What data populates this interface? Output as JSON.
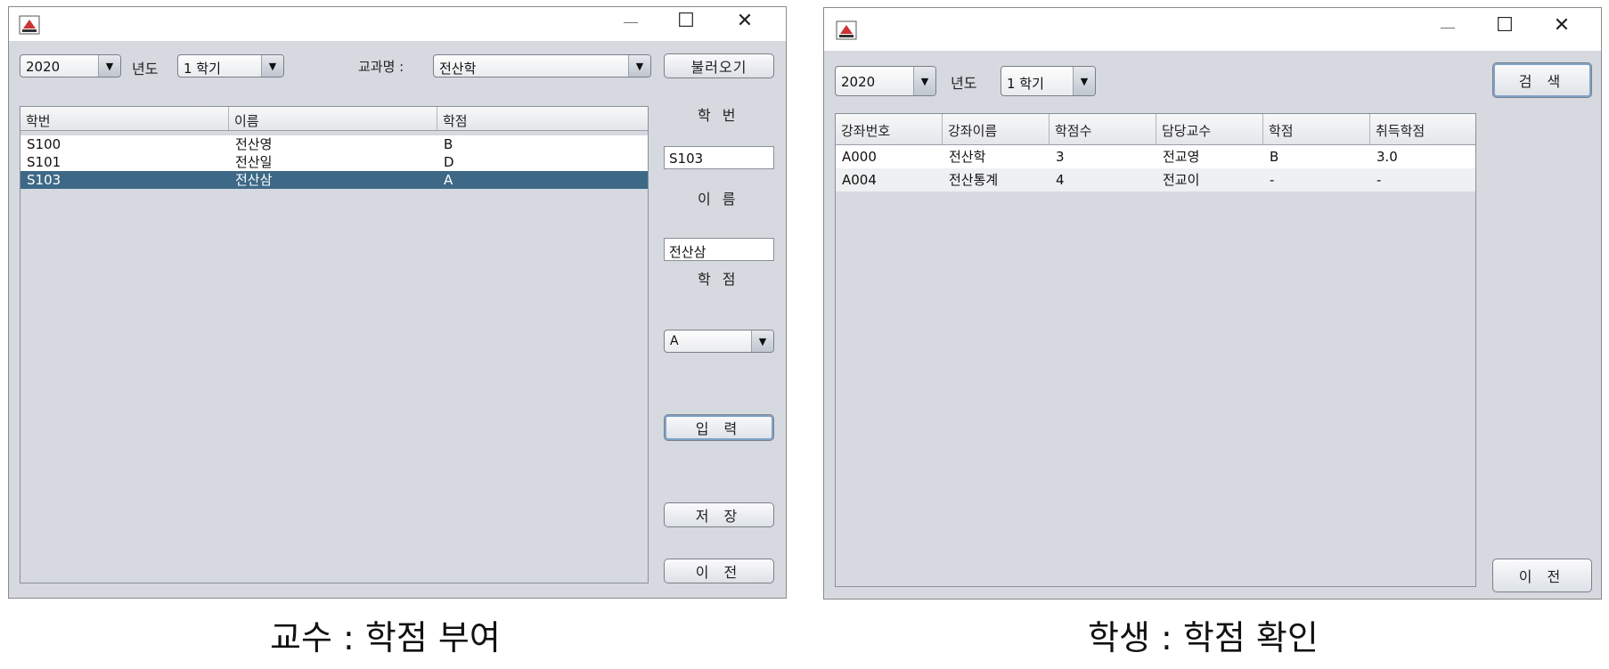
{
  "professor": {
    "window": {
      "minimize": "—",
      "maximize": "☐",
      "close": "✕"
    },
    "year": "2020",
    "year_label": "년도",
    "semester": "1 학기",
    "course_label": "교과명 :",
    "course": "전산학",
    "load_button": "불러오기",
    "table": {
      "columns": [
        "학번",
        "이름",
        "학점"
      ],
      "rows": [
        [
          "S100",
          "전산영",
          "B"
        ],
        [
          "S101",
          "전산일",
          "D"
        ],
        [
          "S103",
          "전산삼",
          "A"
        ]
      ],
      "selected_row": 2
    },
    "student_id_label": "학 번",
    "student_id_value": "S103",
    "name_label": "이 름",
    "name_value": "전산삼",
    "grade_label": "학 점",
    "grade_value": "A",
    "enter_button": "입 력",
    "save_button": "저 장",
    "back_button": "이 전"
  },
  "student": {
    "window": {
      "minimize": "—",
      "maximize": "☐",
      "close": "✕"
    },
    "year": "2020",
    "year_label": "년도",
    "semester": "1 학기",
    "search_button": "검 색",
    "table": {
      "columns": [
        "강좌번호",
        "강좌이름",
        "학점수",
        "담당교수",
        "학점",
        "취득학점"
      ],
      "rows": [
        [
          "A000",
          "전산학",
          "3",
          "전교영",
          "B",
          "3.0"
        ],
        [
          "A004",
          "전산통계",
          "4",
          "전교이",
          "-",
          "-"
        ]
      ]
    },
    "back_button": "이 전"
  },
  "captions": {
    "left": "교수 : 학점 부여",
    "right": "학생 : 학점 확인"
  }
}
